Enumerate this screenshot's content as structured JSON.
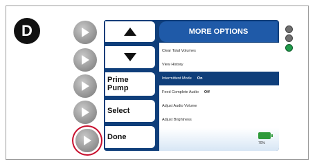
{
  "figure_label": "D",
  "device": {
    "left_buttons": [
      {
        "label": "",
        "icon": "triangle-up-icon"
      },
      {
        "label": "",
        "icon": "triangle-down-icon"
      },
      {
        "label": "Prime\nPump"
      },
      {
        "label": "Select"
      },
      {
        "label": "Done"
      }
    ],
    "menu": {
      "title": "MORE OPTIONS",
      "items": [
        {
          "label": "Clear Total Volumes",
          "value": ""
        },
        {
          "label": "View History",
          "value": ""
        },
        {
          "label": "Intermittent Mode",
          "value": "On",
          "selected": true
        },
        {
          "label": "Feed Complete Audio",
          "value": "Off"
        },
        {
          "label": "Adjust Audio Volume",
          "value": ""
        },
        {
          "label": "Adjust Brightness",
          "value": ""
        }
      ]
    },
    "battery_percent": "70%"
  },
  "indicators": [
    {
      "name": "indicator-light",
      "color": "#6f6f6f"
    },
    {
      "name": "indicator-light",
      "color": "#6f6f6f"
    },
    {
      "name": "indicator-light",
      "color": "#1f9a4a"
    }
  ],
  "colors": {
    "highlight_ring": "#c8102e",
    "menu_blue": "#0f3e7a"
  }
}
